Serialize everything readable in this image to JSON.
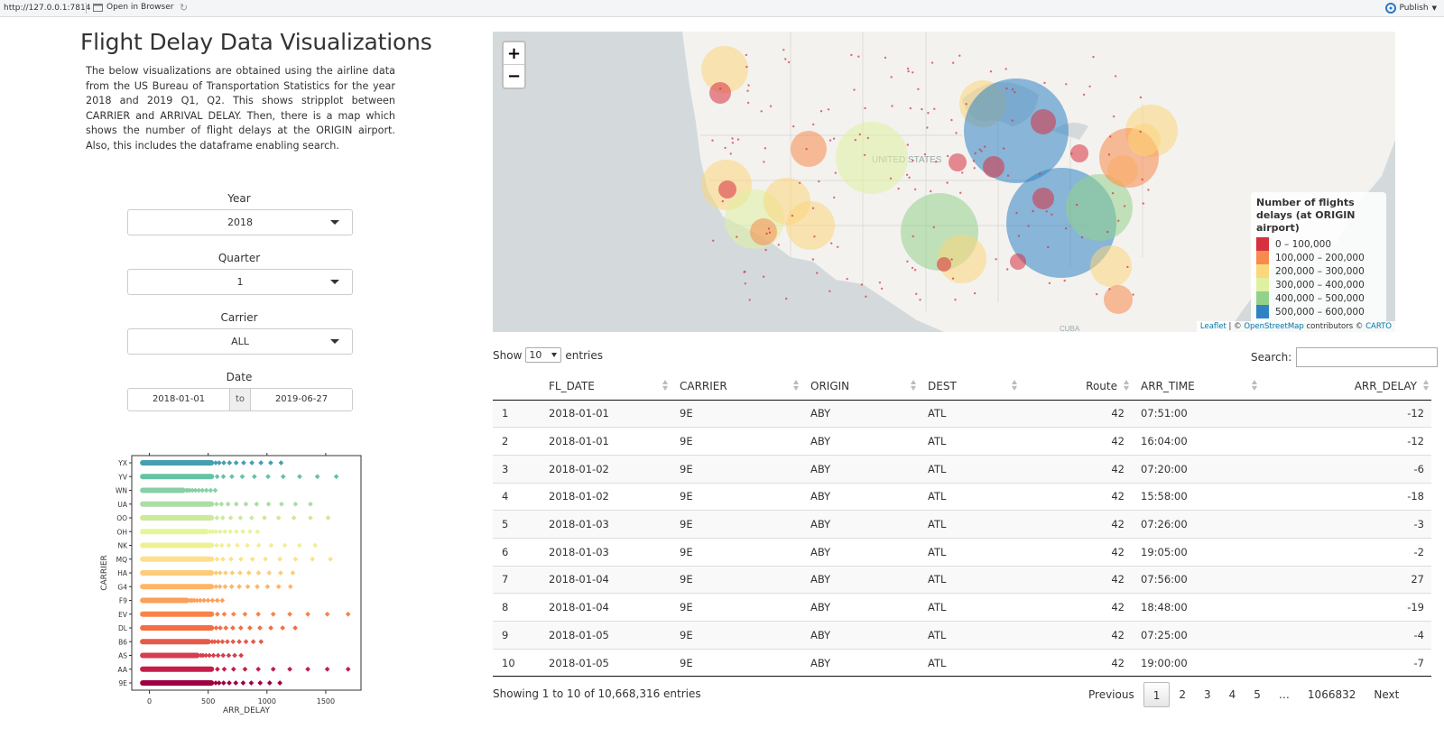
{
  "toolbar": {
    "url": "http://127.0.0.1:7814",
    "open_in_browser": "Open in Browser",
    "publish": "Publish"
  },
  "page": {
    "title": "Flight Delay Data Visualizations",
    "description": "The below visualizations are obtained using the airline data from the US Bureau of Transportation Statistics for the year 2018 and 2019 Q1, Q2. This shows stripplot between CARRIER and ARRIVAL DELAY. Then, there is a map which shows the number of flight delays at the ORIGIN airport. Also, this includes the dataframe enabling search."
  },
  "controls": {
    "year": {
      "label": "Year",
      "value": "2018"
    },
    "quarter": {
      "label": "Quarter",
      "value": "1"
    },
    "carrier": {
      "label": "Carrier",
      "value": "ALL"
    },
    "date": {
      "label": "Date",
      "start": "2018-01-01",
      "separator": "to",
      "end": "2019-06-27"
    }
  },
  "chart_data": {
    "type": "scatter",
    "xlabel": "ARR_DELAY",
    "ylabel": "CARRIER",
    "xticks": [
      0,
      500,
      1000,
      1500
    ],
    "xlim": [
      -150,
      1800
    ],
    "categories": [
      "9E",
      "AA",
      "AS",
      "B6",
      "DL",
      "EV",
      "F9",
      "G4",
      "HA",
      "MQ",
      "NK",
      "OH",
      "OO",
      "UA",
      "WN",
      "YV",
      "YX"
    ],
    "max_delay": [
      1110,
      1690,
      780,
      950,
      1240,
      1690,
      620,
      1200,
      1220,
      1540,
      1410,
      920,
      1520,
      1370,
      560,
      1590,
      1120
    ],
    "colors": [
      "#9e0142",
      "#c51d4a",
      "#d53e4f",
      "#e55a49",
      "#f46d43",
      "#f7844a",
      "#fb9f5a",
      "#fdb567",
      "#fdcc79",
      "#fee08b",
      "#f1ef95",
      "#e6f598",
      "#cde99b",
      "#abdda4",
      "#88cfa4",
      "#66c2a5",
      "#469eb0"
    ]
  },
  "map": {
    "zoom_in": "+",
    "zoom_out": "−",
    "label_country": "UNITED STATES",
    "label_cuba": "CUBA",
    "legend": {
      "title": "Number of flights delays (at ORIGIN airport)",
      "items": [
        {
          "label": "0 – 100,000",
          "color": "#d7303f"
        },
        {
          "label": "100,000 – 200,000",
          "color": "#f88a4d"
        },
        {
          "label": "200,000 – 300,000",
          "color": "#fbd67b"
        },
        {
          "label": "300,000 – 400,000",
          "color": "#dff0a0"
        },
        {
          "label": "400,000 – 500,000",
          "color": "#93d18b"
        },
        {
          "label": "500,000 – 600,000",
          "color": "#2f83c4"
        }
      ]
    },
    "attribution": {
      "leaflet": "Leaflet",
      "sep": " | © ",
      "osm": "OpenStreetMap",
      "mid": " contributors © ",
      "carto": "CARTO"
    }
  },
  "table": {
    "show": "Show",
    "length": "10",
    "entries": "entries",
    "search_label": "Search:",
    "columns": [
      "",
      "FL_DATE",
      "CARRIER",
      "ORIGIN",
      "DEST",
      "Route",
      "ARR_TIME",
      "ARR_DELAY"
    ],
    "rows": [
      [
        "1",
        "2018-01-01",
        "9E",
        "ABY",
        "ATL",
        "42",
        "07:51:00",
        "-12"
      ],
      [
        "2",
        "2018-01-01",
        "9E",
        "ABY",
        "ATL",
        "42",
        "16:04:00",
        "-12"
      ],
      [
        "3",
        "2018-01-02",
        "9E",
        "ABY",
        "ATL",
        "42",
        "07:20:00",
        "-6"
      ],
      [
        "4",
        "2018-01-02",
        "9E",
        "ABY",
        "ATL",
        "42",
        "15:58:00",
        "-18"
      ],
      [
        "5",
        "2018-01-03",
        "9E",
        "ABY",
        "ATL",
        "42",
        "07:26:00",
        "-3"
      ],
      [
        "6",
        "2018-01-03",
        "9E",
        "ABY",
        "ATL",
        "42",
        "19:05:00",
        "-2"
      ],
      [
        "7",
        "2018-01-04",
        "9E",
        "ABY",
        "ATL",
        "42",
        "07:56:00",
        "27"
      ],
      [
        "8",
        "2018-01-04",
        "9E",
        "ABY",
        "ATL",
        "42",
        "18:48:00",
        "-19"
      ],
      [
        "9",
        "2018-01-05",
        "9E",
        "ABY",
        "ATL",
        "42",
        "07:25:00",
        "-4"
      ],
      [
        "10",
        "2018-01-05",
        "9E",
        "ABY",
        "ATL",
        "42",
        "19:00:00",
        "-7"
      ]
    ],
    "info": "Showing 1 to 10 of 10,668,316 entries",
    "pager": {
      "previous": "Previous",
      "pages": [
        "1",
        "2",
        "3",
        "4",
        "5"
      ],
      "ellipsis": "…",
      "last": "1066832",
      "next": "Next"
    }
  }
}
